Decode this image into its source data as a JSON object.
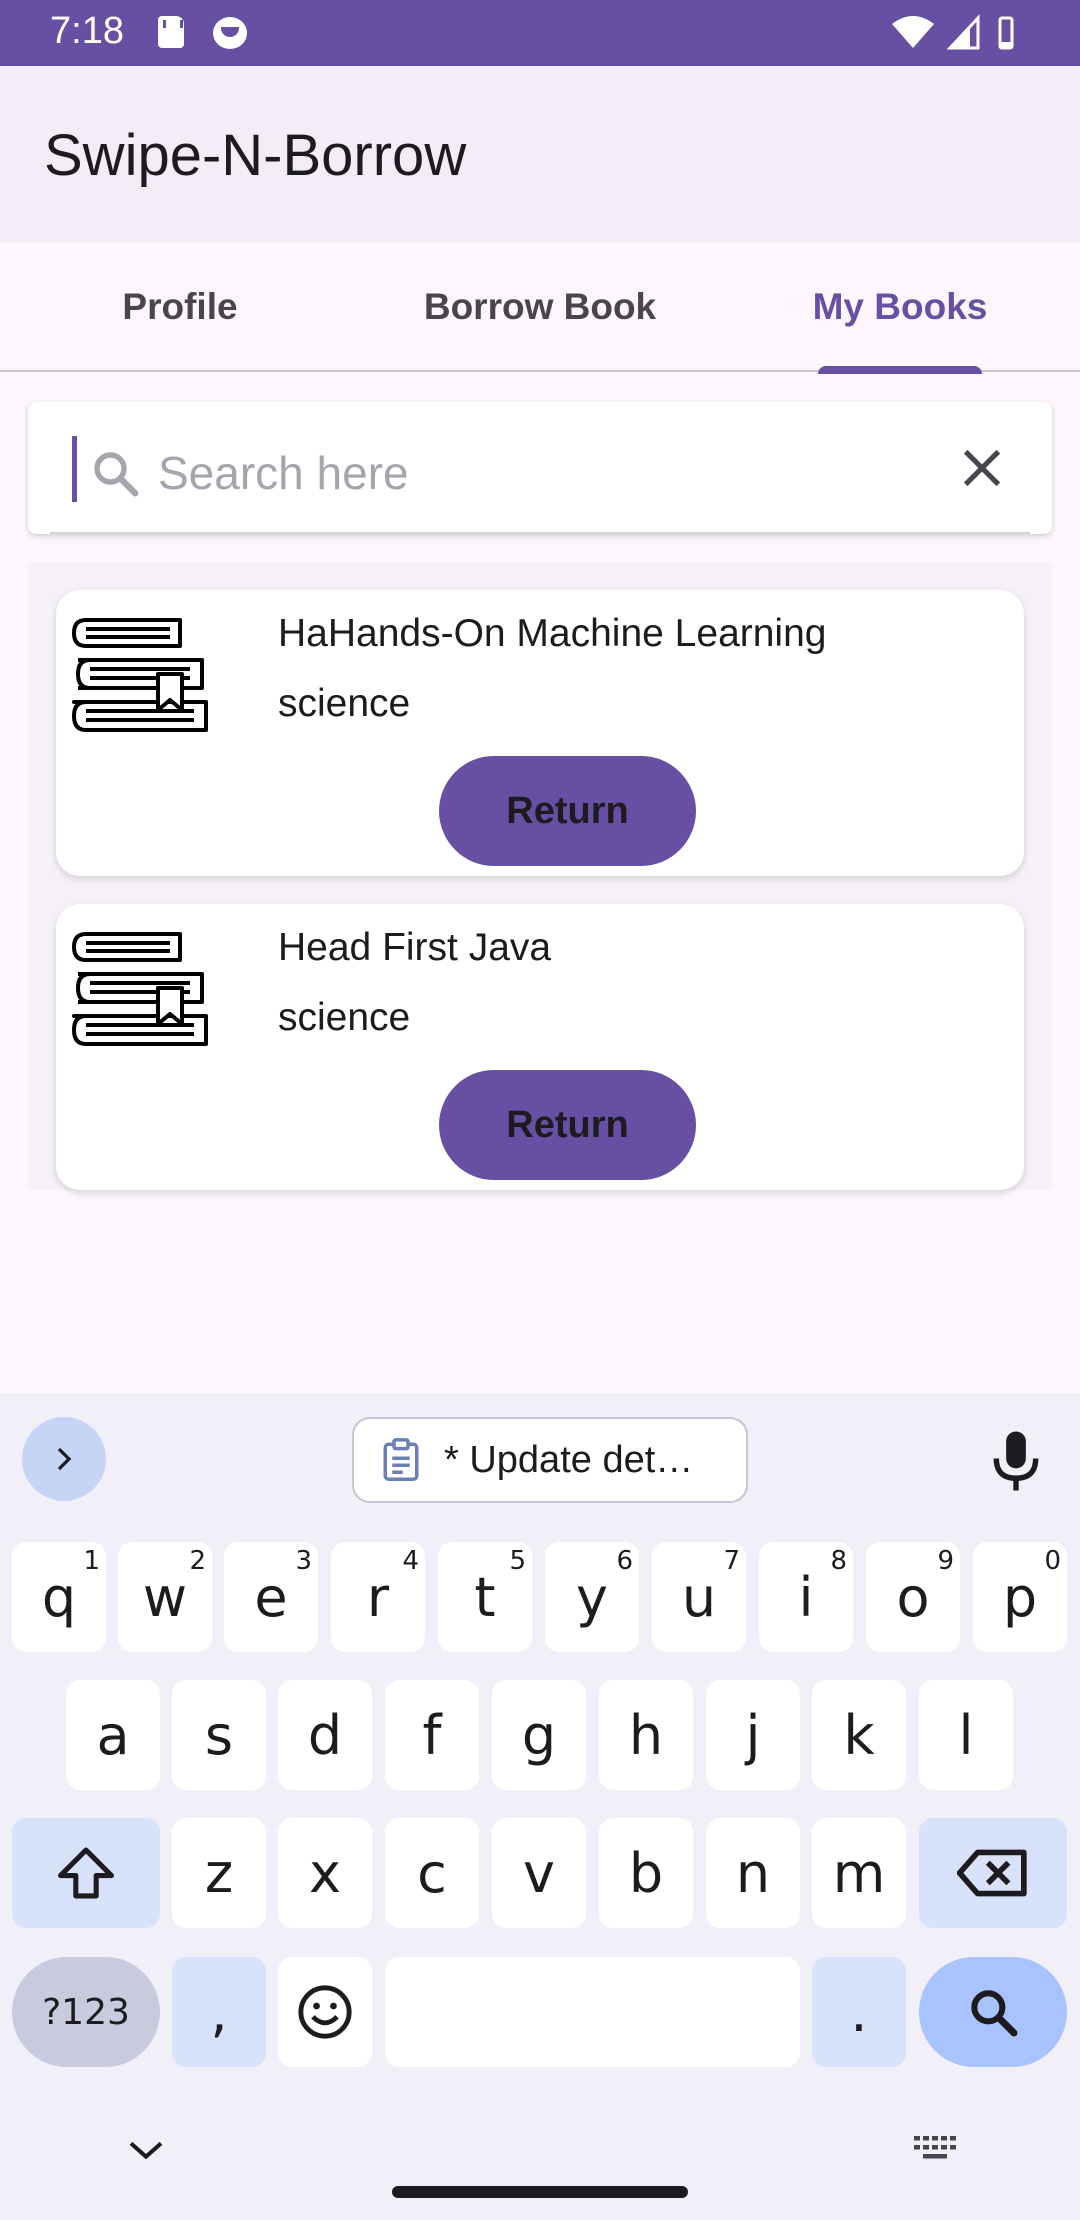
{
  "status_bar": {
    "time": "7:18"
  },
  "app_bar": {
    "title": "Swipe-N-Borrow"
  },
  "tabs": [
    {
      "label": "Profile",
      "active": false
    },
    {
      "label": "Borrow Book",
      "active": false
    },
    {
      "label": "My Books",
      "active": true
    }
  ],
  "search": {
    "placeholder": "Search here",
    "value": ""
  },
  "books": [
    {
      "name": "HaHands-On Machine Learning",
      "category": "science",
      "action": "Return"
    },
    {
      "name": "Head First Java",
      "category": "science",
      "action": "Return"
    }
  ],
  "keyboard": {
    "clipboard_suggestion": "* Update det…",
    "row1": [
      {
        "key": "q",
        "alt": "1"
      },
      {
        "key": "w",
        "alt": "2"
      },
      {
        "key": "e",
        "alt": "3"
      },
      {
        "key": "r",
        "alt": "4"
      },
      {
        "key": "t",
        "alt": "5"
      },
      {
        "key": "y",
        "alt": "6"
      },
      {
        "key": "u",
        "alt": "7"
      },
      {
        "key": "i",
        "alt": "8"
      },
      {
        "key": "o",
        "alt": "9"
      },
      {
        "key": "p",
        "alt": "0"
      }
    ],
    "row2": [
      "a",
      "s",
      "d",
      "f",
      "g",
      "h",
      "j",
      "k",
      "l"
    ],
    "row3": [
      "z",
      "x",
      "c",
      "v",
      "b",
      "n",
      "m"
    ],
    "symbols_label": "?123",
    "comma": ",",
    "period": "."
  },
  "colors": {
    "primary": "#6750a4",
    "surface": "#fdf7fd",
    "app_bar": "#f3edf7",
    "keyboard_bg": "#f1eff7",
    "key_mod": "#d9e2fb",
    "key_action": "#a9c3ff"
  },
  "icons": {
    "search": "search-icon",
    "clear": "close-icon",
    "book": "book-stack-icon",
    "mic": "microphone-icon",
    "clipboard": "clipboard-icon",
    "shift": "shift-icon",
    "backspace": "backspace-icon",
    "emoji": "emoji-icon",
    "keyboard_search": "search-icon"
  }
}
